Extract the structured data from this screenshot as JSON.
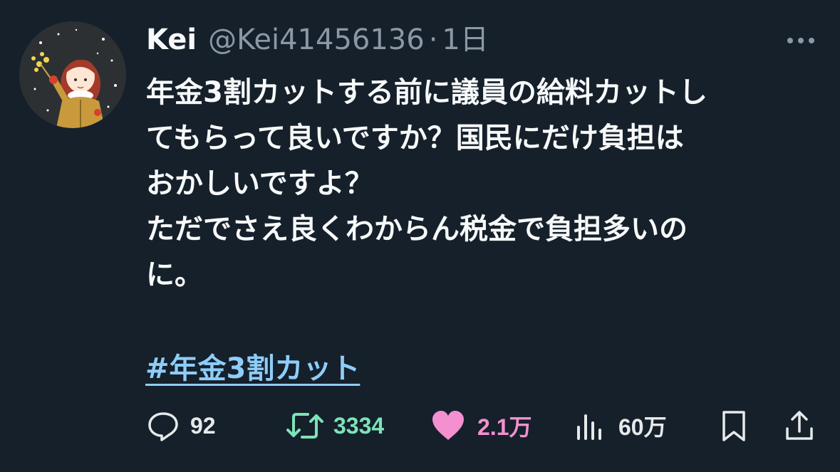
{
  "tweet": {
    "display_name": "Kei",
    "handle": "@Kei41456136",
    "separator": "·",
    "time": "1日",
    "body_lines": [
      "年金3割カットする前に議員の給料カットし",
      "てもらって良いですか？国民にだけ負担は",
      "おかしいですよ？",
      "ただでさえ良くわからん税金で負担多いの",
      "に。"
    ],
    "hashtag": "#年金3割カット"
  },
  "actions": {
    "reply": {
      "icon": "reply-icon",
      "count": "92"
    },
    "retweet": {
      "icon": "retweet-icon",
      "count": "3334"
    },
    "like": {
      "icon": "heart-icon",
      "count": "2.1万"
    },
    "views": {
      "icon": "bar-chart-icon",
      "count": "60万"
    },
    "bookmark": {
      "icon": "bookmark-icon"
    },
    "share": {
      "icon": "share-icon"
    }
  },
  "colors": {
    "background": "#15202b",
    "text": "#f7f9f9",
    "muted": "#8b98a5",
    "hashtag": "#8ecdf8",
    "retweet": "#7ee2b8",
    "like": "#f48fd0",
    "icon": "#e7e9ea"
  }
}
